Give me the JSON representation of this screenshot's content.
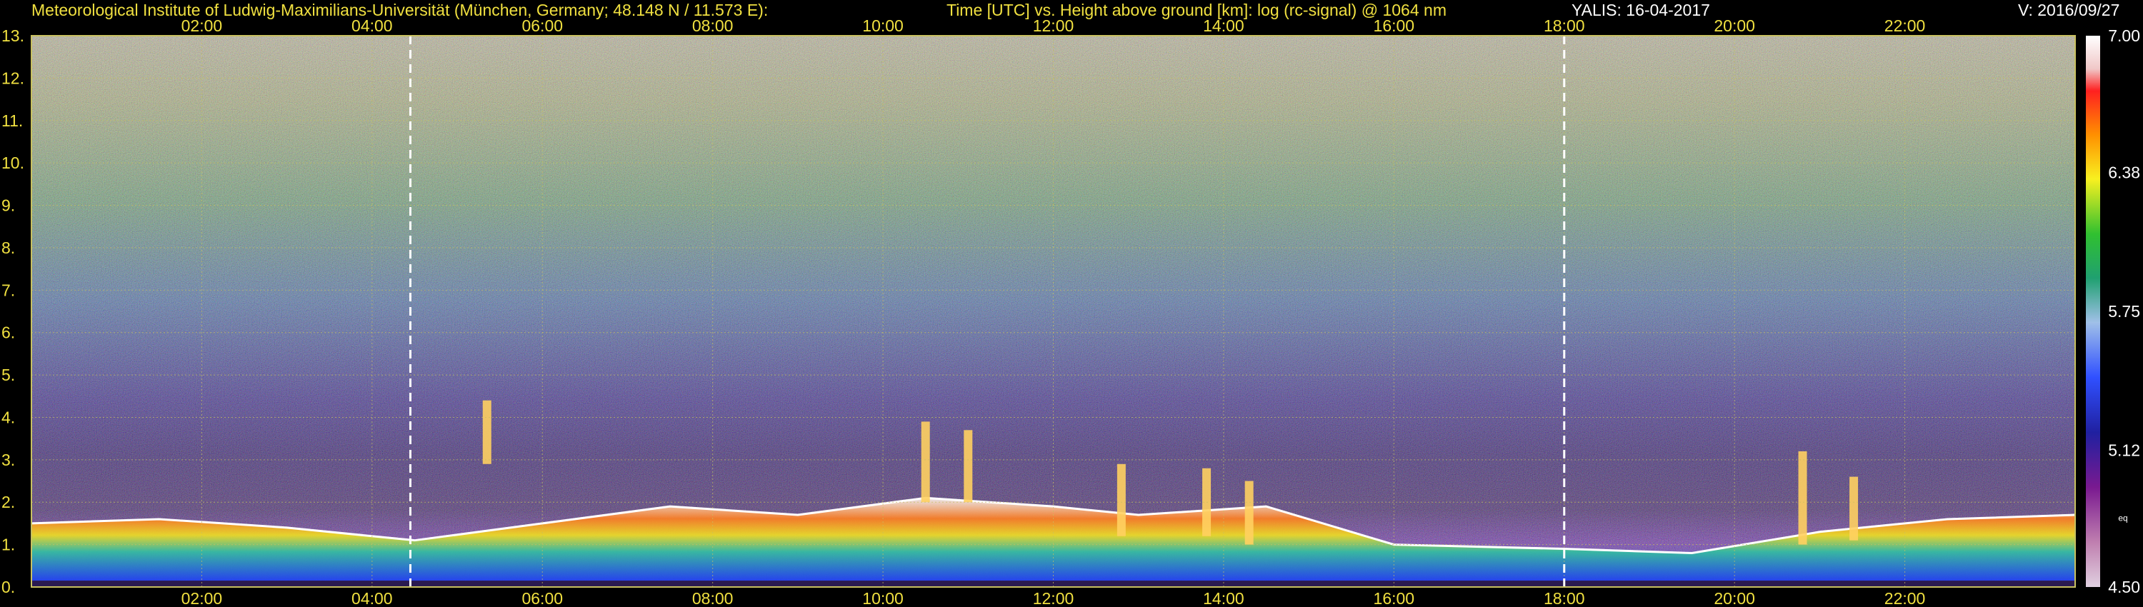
{
  "header": {
    "institute": "Meteorological Institute of Ludwig-Maximilians-Universität (München, Germany; 48.148 N / 11.573 E):",
    "axes_desc": "Time [UTC] vs. Height above ground [km]: log (rc-signal) @ 1064 nm",
    "instrument": "YALIS: 16-04-2017",
    "version": "V: 2016/09/27"
  },
  "chart_data": {
    "type": "heatmap",
    "title": "Time [UTC] vs. Height above ground [km]: log (rc-signal) @ 1064 nm",
    "xlabel": "Time [UTC]",
    "ylabel": "Height above ground [km]",
    "x_ticks": [
      "02:00",
      "04:00",
      "06:00",
      "08:00",
      "10:00",
      "12:00",
      "14:00",
      "16:00",
      "18:00",
      "20:00",
      "22:00"
    ],
    "x_tick_hours": [
      2,
      4,
      6,
      8,
      10,
      12,
      14,
      16,
      18,
      20,
      22
    ],
    "xlim": [
      0,
      24
    ],
    "y_ticks": [
      "0.",
      "1.",
      "2.",
      "3.",
      "4.",
      "5.",
      "6.",
      "7.",
      "8.",
      "9.",
      "10.",
      "11.",
      "12.",
      "13."
    ],
    "y_tick_values": [
      0,
      1,
      2,
      3,
      4,
      5,
      6,
      7,
      8,
      9,
      10,
      11,
      12,
      13
    ],
    "ylim": [
      0,
      13
    ],
    "grid": true,
    "dashed_markers_hours": [
      4.45,
      18.0
    ],
    "colorbar": {
      "label": "eq",
      "min": 4.5,
      "max": 7.0,
      "ticks": [
        "7.00",
        "6.38",
        "5.75",
        "5.12",
        "4.50"
      ],
      "tick_values": [
        7.0,
        6.38,
        5.75,
        5.12,
        4.5
      ]
    },
    "boundary_layer_top_km": [
      {
        "hour": 0.0,
        "km": 1.5
      },
      {
        "hour": 1.5,
        "km": 1.6
      },
      {
        "hour": 3.0,
        "km": 1.4
      },
      {
        "hour": 4.5,
        "km": 1.1
      },
      {
        "hour": 6.0,
        "km": 1.5
      },
      {
        "hour": 7.5,
        "km": 1.9
      },
      {
        "hour": 9.0,
        "km": 1.7
      },
      {
        "hour": 10.5,
        "km": 2.1
      },
      {
        "hour": 12.0,
        "km": 1.9
      },
      {
        "hour": 13.0,
        "km": 1.7
      },
      {
        "hour": 14.5,
        "km": 1.9
      },
      {
        "hour": 16.0,
        "km": 1.0
      },
      {
        "hour": 18.0,
        "km": 0.9
      },
      {
        "hour": 19.5,
        "km": 0.8
      },
      {
        "hour": 21.0,
        "km": 1.3
      },
      {
        "hour": 22.5,
        "km": 1.6
      },
      {
        "hour": 24.0,
        "km": 1.7
      }
    ],
    "cloud_plumes": [
      {
        "hour": 5.35,
        "bottom_km": 2.9,
        "top_km": 4.4
      },
      {
        "hour": 10.5,
        "bottom_km": 2.0,
        "top_km": 3.9
      },
      {
        "hour": 11.0,
        "bottom_km": 2.0,
        "top_km": 3.7
      },
      {
        "hour": 12.8,
        "bottom_km": 1.2,
        "top_km": 2.9
      },
      {
        "hour": 13.8,
        "bottom_km": 1.2,
        "top_km": 2.8
      },
      {
        "hour": 14.3,
        "bottom_km": 1.0,
        "top_km": 2.5
      },
      {
        "hour": 20.8,
        "bottom_km": 1.0,
        "top_km": 3.2
      },
      {
        "hour": 21.4,
        "bottom_km": 1.1,
        "top_km": 2.6
      }
    ]
  }
}
